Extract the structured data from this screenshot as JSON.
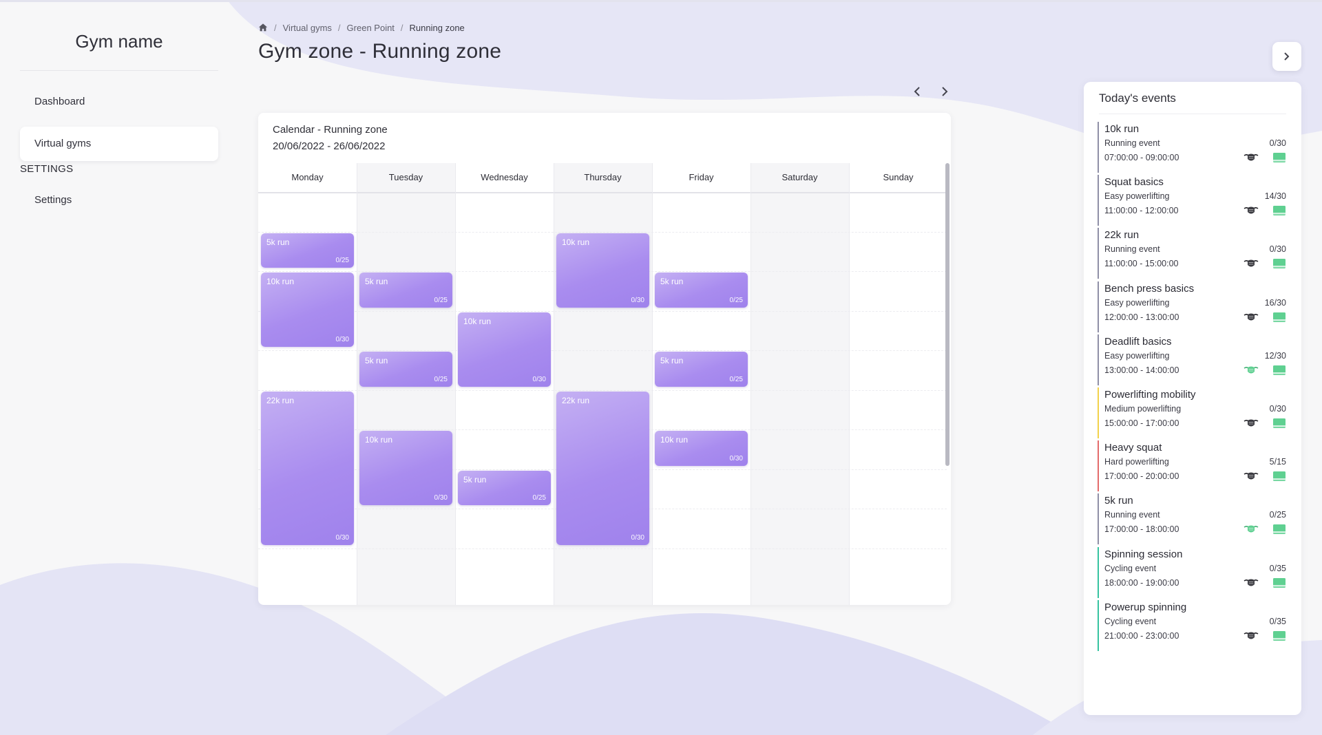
{
  "app": {
    "brand": "Gym name"
  },
  "colors": {
    "accent_event": "#a98cef",
    "status_green": "#5fd091",
    "border_default": "#8f8fa6",
    "border_yellow": "#f2d24a",
    "border_red": "#e46a6a",
    "border_teal": "#35c3a0"
  },
  "sidebar": {
    "items": [
      {
        "label": "Dashboard"
      },
      {
        "label": "Virtual gyms",
        "active": true
      }
    ],
    "section": "SETTINGS",
    "settings_items": [
      {
        "label": "Settings"
      }
    ]
  },
  "breadcrumb": {
    "home_icon": "home-icon",
    "items": [
      "Virtual gyms",
      "Green Point",
      "Running zone"
    ]
  },
  "page": {
    "title": "Gym zone - Running zone"
  },
  "calendar": {
    "title": "Calendar - Running zone",
    "range": "20/06/2022 - 26/06/2022",
    "days": [
      "Monday",
      "Tuesday",
      "Wednesday",
      "Thursday",
      "Friday",
      "Saturday",
      "Sunday"
    ],
    "events": [
      {
        "day": 0,
        "start": 1,
        "end": 2,
        "name": "5k run",
        "capacity": "0/25"
      },
      {
        "day": 0,
        "start": 2,
        "end": 4,
        "name": "10k run",
        "capacity": "0/30"
      },
      {
        "day": 0,
        "start": 5,
        "end": 9,
        "name": "22k run",
        "capacity": "0/30"
      },
      {
        "day": 1,
        "start": 2,
        "end": 3,
        "name": "5k run",
        "capacity": "0/25"
      },
      {
        "day": 1,
        "start": 4,
        "end": 5,
        "name": "5k run",
        "capacity": "0/25"
      },
      {
        "day": 1,
        "start": 6,
        "end": 8,
        "name": "10k run",
        "capacity": "0/30"
      },
      {
        "day": 2,
        "start": 3,
        "end": 5,
        "name": "10k run",
        "capacity": "0/30"
      },
      {
        "day": 2,
        "start": 7,
        "end": 8,
        "name": "5k run",
        "capacity": "0/25"
      },
      {
        "day": 3,
        "start": 1,
        "end": 3,
        "name": "10k run",
        "capacity": "0/30"
      },
      {
        "day": 3,
        "start": 5,
        "end": 9,
        "name": "22k run",
        "capacity": "0/30"
      },
      {
        "day": 4,
        "start": 2,
        "end": 3,
        "name": "5k run",
        "capacity": "0/25"
      },
      {
        "day": 4,
        "start": 4,
        "end": 5,
        "name": "5k run",
        "capacity": "0/25"
      },
      {
        "day": 4,
        "start": 6,
        "end": 7,
        "name": "10k run",
        "capacity": "0/30"
      }
    ]
  },
  "today": {
    "title": "Today's events",
    "events": [
      {
        "title": "10k run",
        "category": "Running event",
        "capacity": "0/30",
        "hours": "07:00:00 - 09:00:00",
        "border": "default",
        "mask_green": false
      },
      {
        "title": "Squat basics",
        "category": "Easy powerlifting",
        "capacity": "14/30",
        "hours": "11:00:00 - 12:00:00",
        "border": "default",
        "mask_green": false
      },
      {
        "title": "22k run",
        "category": "Running event",
        "capacity": "0/30",
        "hours": "11:00:00 - 15:00:00",
        "border": "default",
        "mask_green": false
      },
      {
        "title": "Bench press basics",
        "category": "Easy powerlifting",
        "capacity": "16/30",
        "hours": "12:00:00 - 13:00:00",
        "border": "default",
        "mask_green": false
      },
      {
        "title": "Deadlift basics",
        "category": "Easy powerlifting",
        "capacity": "12/30",
        "hours": "13:00:00 - 14:00:00",
        "border": "default",
        "mask_green": true
      },
      {
        "title": "Powerlifting mobility",
        "category": "Medium powerlifting",
        "capacity": "0/30",
        "hours": "15:00:00 - 17:00:00",
        "border": "yellow",
        "mask_green": false
      },
      {
        "title": "Heavy squat",
        "category": "Hard powerlifting",
        "capacity": "5/15",
        "hours": "17:00:00 - 20:00:00",
        "border": "red",
        "mask_green": false
      },
      {
        "title": "5k run",
        "category": "Running event",
        "capacity": "0/25",
        "hours": "17:00:00 - 18:00:00",
        "border": "default",
        "mask_green": true
      },
      {
        "title": "Spinning session",
        "category": "Cycling event",
        "capacity": "0/35",
        "hours": "18:00:00 - 19:00:00",
        "border": "teal",
        "mask_green": false
      },
      {
        "title": "Powerup spinning",
        "category": "Cycling event",
        "capacity": "0/35",
        "hours": "21:00:00 - 23:00:00",
        "border": "teal",
        "mask_green": false
      }
    ]
  }
}
